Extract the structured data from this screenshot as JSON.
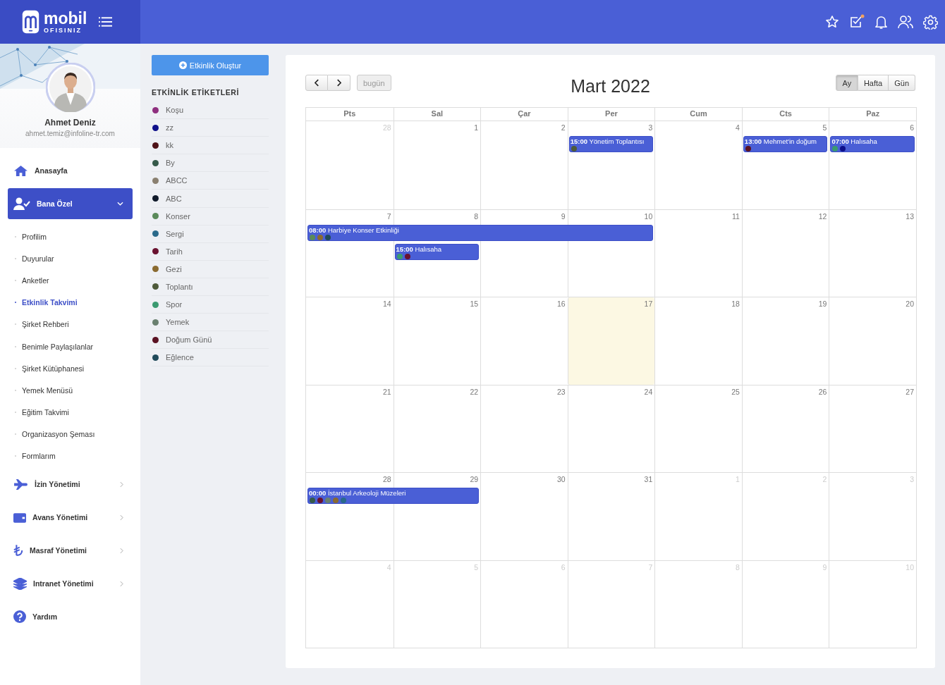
{
  "brand": {
    "name": "mobil",
    "tagline": "OFISINIZ"
  },
  "header_icons": [
    {
      "kind": "star"
    },
    {
      "kind": "tasks",
      "badge": true
    },
    {
      "kind": "bell"
    },
    {
      "kind": "users"
    },
    {
      "kind": "gear"
    }
  ],
  "profile": {
    "name": "Ahmet Deniz",
    "email": "ahmet.temiz@infoline-tr.com"
  },
  "sidebar": {
    "items": [
      {
        "kind": "home",
        "label": "Anasayfa",
        "selected": false
      },
      {
        "kind": "user",
        "label": "Bana Özel",
        "selected": true,
        "expanded": true,
        "children": [
          {
            "label": "Profilim",
            "selected": false
          },
          {
            "label": "Duyurular",
            "selected": false
          },
          {
            "label": "Anketler",
            "selected": false
          },
          {
            "label": "Etkinlik Takvimi",
            "selected": true
          },
          {
            "label": "Şirket Rehberi",
            "selected": false
          },
          {
            "label": "Benimle Paylaşılanlar",
            "selected": false
          },
          {
            "label": "Şirket Kütüphanesi",
            "selected": false
          },
          {
            "label": "Yemek Menüsü",
            "selected": false
          },
          {
            "label": "Eğitim Takvimi",
            "selected": false
          },
          {
            "label": "Organizasyon Şeması",
            "selected": false
          },
          {
            "label": "Formlarım",
            "selected": false
          }
        ]
      },
      {
        "kind": "plane",
        "label": "İzin Yönetimi",
        "selected": false
      },
      {
        "kind": "wallet",
        "label": "Avans Yönetimi",
        "selected": false
      },
      {
        "kind": "lira",
        "label": "Masraf Yönetimi",
        "selected": false
      },
      {
        "kind": "layers",
        "label": "Intranet Yönetimi",
        "selected": false
      },
      {
        "kind": "help",
        "label": "Yardım",
        "selected": false
      }
    ]
  },
  "create_button": "Etkinlik Oluştur",
  "tags_title": "ETKİNLİK ETİKETLERİ",
  "tags": [
    {
      "name": "Koşu",
      "color": "#8e2e7e"
    },
    {
      "name": "zz",
      "color": "#0e108a"
    },
    {
      "name": "kk",
      "color": "#4e1218"
    },
    {
      "name": "By",
      "color": "#355a4a"
    },
    {
      "name": "ABCC",
      "color": "#8a8070"
    },
    {
      "name": "ABC",
      "color": "#101a2a"
    },
    {
      "name": "Konser",
      "color": "#5a8a5a"
    },
    {
      "name": "Sergi",
      "color": "#2a6a8a"
    },
    {
      "name": "Tarih",
      "color": "#6a1230"
    },
    {
      "name": "Gezi",
      "color": "#8a6a30"
    },
    {
      "name": "Toplantı",
      "color": "#4e5a3a"
    },
    {
      "name": "Spor",
      "color": "#3a9a70"
    },
    {
      "name": "Yemek",
      "color": "#6a8070"
    },
    {
      "name": "Doğum Günü",
      "color": "#5a1222"
    },
    {
      "name": "Eğlence",
      "color": "#204a5a"
    }
  ],
  "calendar": {
    "title": "Mart 2022",
    "today_button": "bugün",
    "views": [
      {
        "label": "Ay",
        "selected": true
      },
      {
        "label": "Hafta",
        "selected": false
      },
      {
        "label": "Gün",
        "selected": false
      }
    ],
    "weekdays": [
      "Pts",
      "Sal",
      "Çar",
      "Per",
      "Cum",
      "Cts",
      "Paz"
    ],
    "weeks": [
      {
        "days": [
          {
            "day": "28",
            "other_month": true
          },
          {
            "day": "1"
          },
          {
            "day": "2"
          },
          {
            "day": "3",
            "events": [
              {
                "time": "15:00",
                "title": "Yönetim Toplantısı",
                "dots": [
                  {
                    "color": "#4e5a3a"
                  }
                ]
              }
            ]
          },
          {
            "day": "4"
          },
          {
            "day": "5",
            "events": [
              {
                "time": "13:00",
                "title": "Mehmet'in doğum",
                "dots": [
                  {
                    "color": "#5a1222"
                  }
                ]
              }
            ]
          },
          {
            "day": "6",
            "events": [
              {
                "time": "07:00",
                "title": "Halısaha",
                "dots": [
                  {
                    "color": "#3a9a70"
                  },
                  {
                    "color": "#0e108a"
                  }
                ]
              }
            ]
          }
        ]
      },
      {
        "days": [
          {
            "day": "7",
            "events": [
              {
                "time": "08:00",
                "title": "Harbiye Konser Etkinliği",
                "dots": [
                  {
                    "color": "#5a8a5a"
                  },
                  {
                    "color": "#8a6a30"
                  },
                  {
                    "color": "#204a5a"
                  }
                ]
              }
            ]
          },
          {
            "day": "8",
            "event_continues": true,
            "events": [
              {
                "time": "15:00",
                "title": "Halısaha",
                "dots": [
                  {
                    "color": "#3a9a70"
                  },
                  {
                    "color": "#6a1230"
                  }
                ]
              }
            ]
          },
          {
            "day": "9",
            "event_continues": true
          },
          {
            "day": "10",
            "event_continues": true
          },
          {
            "day": "11"
          },
          {
            "day": "12"
          },
          {
            "day": "13"
          }
        ]
      },
      {
        "days": [
          {
            "day": "14"
          },
          {
            "day": "15"
          },
          {
            "day": "16"
          },
          {
            "day": "17",
            "today": true
          },
          {
            "day": "18"
          },
          {
            "day": "19"
          },
          {
            "day": "20"
          }
        ]
      },
      {
        "days": [
          {
            "day": "21"
          },
          {
            "day": "22"
          },
          {
            "day": "23"
          },
          {
            "day": "24"
          },
          {
            "day": "25"
          },
          {
            "day": "26"
          },
          {
            "day": "27"
          }
        ]
      },
      {
        "days": [
          {
            "day": "28",
            "events": [
              {
                "time": "00:00",
                "title": "İstanbul Arkeoloji Müzeleri",
                "dots": [
                  {
                    "color": "#355a4a"
                  },
                  {
                    "color": "#6a1230"
                  },
                  {
                    "color": "#6a8070"
                  },
                  {
                    "color": "#8a6a30"
                  },
                  {
                    "color": "#2a6a8a"
                  }
                ]
              }
            ]
          },
          {
            "day": "29",
            "event_continues": true
          },
          {
            "day": "30"
          },
          {
            "day": "31"
          },
          {
            "day": "1",
            "other_month": true
          },
          {
            "day": "2",
            "other_month": true
          },
          {
            "day": "3",
            "other_month": true
          }
        ]
      },
      {
        "days": [
          {
            "day": "4",
            "other_month": true
          },
          {
            "day": "5",
            "other_month": true
          },
          {
            "day": "6",
            "other_month": true
          },
          {
            "day": "7",
            "other_month": true
          },
          {
            "day": "8",
            "other_month": true
          },
          {
            "day": "9",
            "other_month": true
          },
          {
            "day": "10",
            "other_month": true
          }
        ]
      }
    ]
  }
}
